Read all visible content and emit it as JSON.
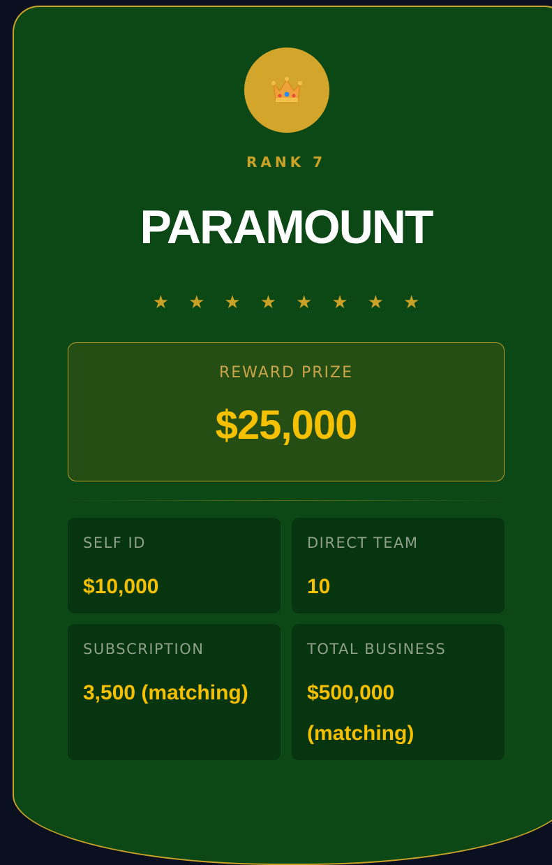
{
  "rank": {
    "icon": "crown-icon",
    "label": "RANK 7",
    "title": "PARAMOUNT",
    "stars": 8
  },
  "reward": {
    "label": "REWARD PRIZE",
    "value": "$25,000"
  },
  "stats": [
    {
      "label": "SELF ID",
      "value": "$10,000"
    },
    {
      "label": "DIRECT TEAM",
      "value": "10"
    },
    {
      "label": "SUBSCRIPTION",
      "value": "3,500 (matching)"
    },
    {
      "label": "TOTAL BUSINESS",
      "value": "$500,000 (matching)"
    }
  ],
  "colors": {
    "card_bg": "#0c4816",
    "gold": "#c9a227",
    "value_yellow": "#f5c000",
    "badge": "#d3a62b"
  }
}
